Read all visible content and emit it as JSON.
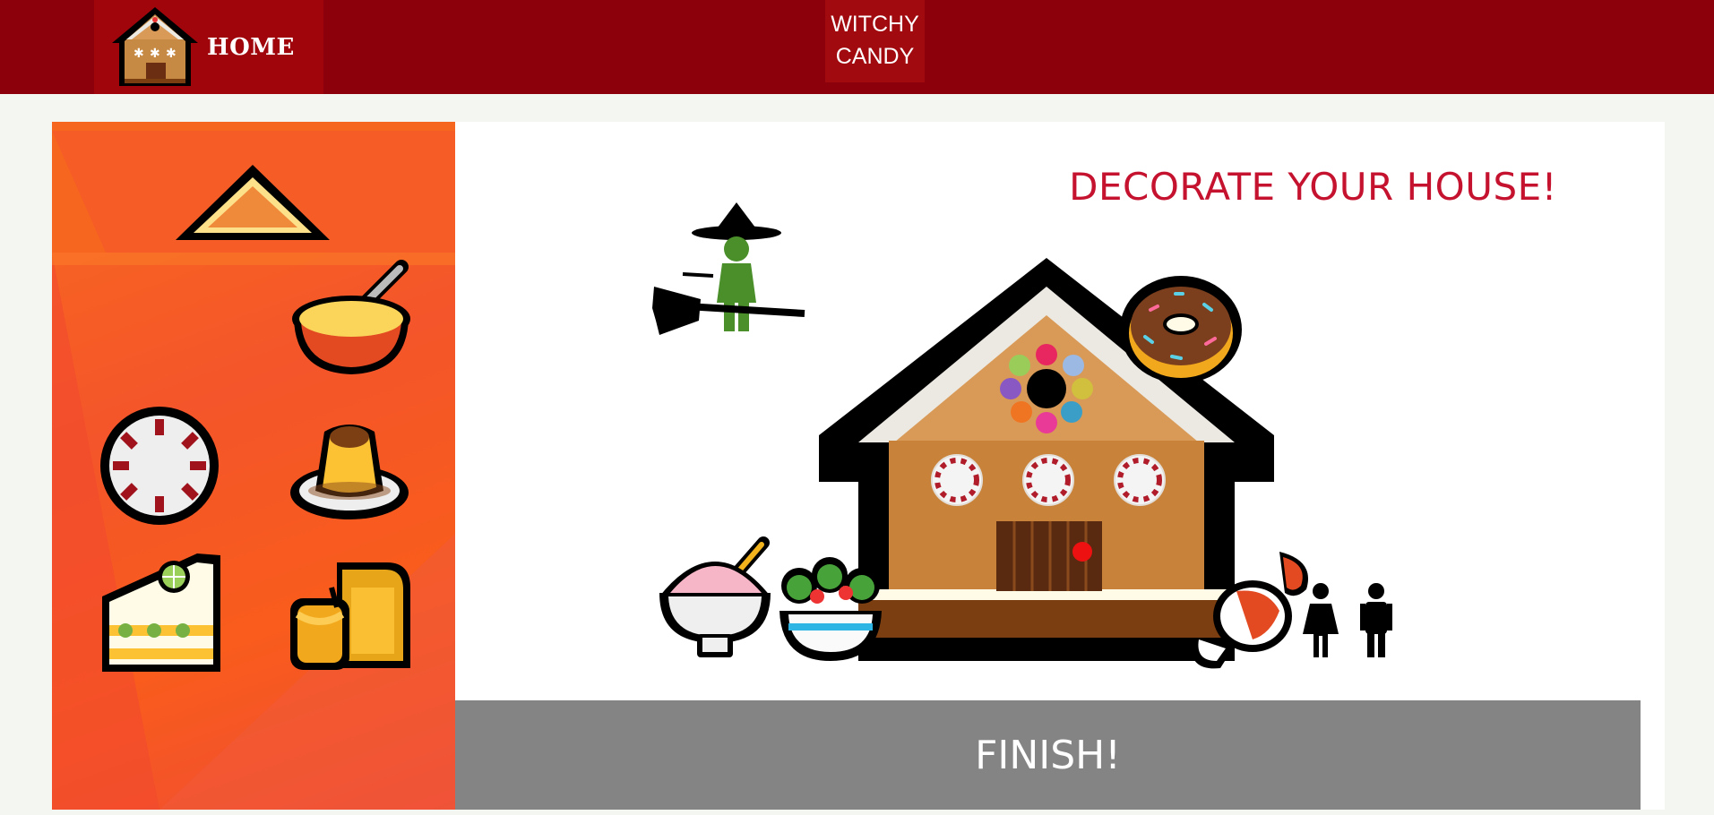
{
  "nav": {
    "home_label": "HOME",
    "brand_line1": "WITCHY",
    "brand_line2": "CANDY"
  },
  "stage": {
    "title": "DECORATE YOUR HOUSE!",
    "finish_label": "FINISH!"
  },
  "palette": {
    "items": [
      "roof-triangle",
      "soup-bowl",
      "peppermint-candy",
      "flan-pudding",
      "lime-cake-slice",
      "honey-bread"
    ]
  },
  "colors": {
    "topbar": "#8b000a",
    "panel": "#f96a1e",
    "title": "#c5122f",
    "finish": "#848484"
  }
}
